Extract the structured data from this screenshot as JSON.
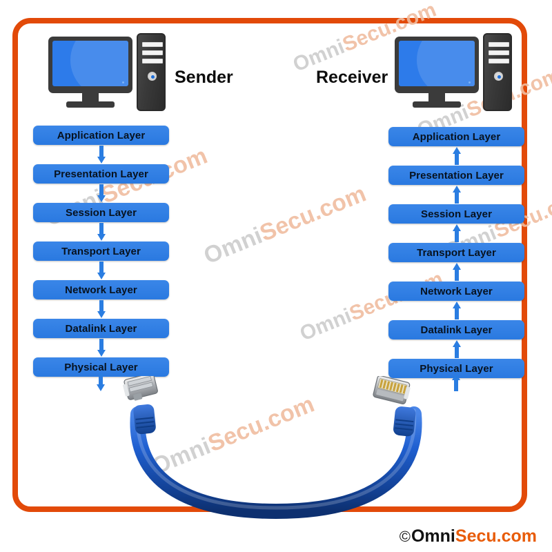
{
  "frame": {
    "border_color": "#E24A09"
  },
  "endpoints": {
    "sender": {
      "label": "Sender",
      "icon": "desktop-computer-icon"
    },
    "receiver": {
      "label": "Receiver",
      "icon": "desktop-computer-icon"
    }
  },
  "layers": {
    "names": [
      "Application Layer",
      "Presentation Layer",
      "Session Layer",
      "Transport Layer",
      "Network Layer",
      "Datalink Layer",
      "Physical Layer"
    ],
    "box_color": "#2a79e0",
    "text_color": "#07121f",
    "arrow_color": "#2a7de1",
    "sender_flow": "down",
    "receiver_flow": "up"
  },
  "cable": {
    "name": "ethernet-cable",
    "color": "#1f5fd0",
    "connector": "rj45-connector"
  },
  "watermarks": {
    "text_a": "Omni",
    "text_b": "Secu.com",
    "color_a": "#c9c9c9",
    "color_b": "#f0bda0"
  },
  "logo": {
    "copyright": "©",
    "part_a": "Omni",
    "part_b": "Secu.com",
    "color_a": "#121212",
    "color_b": "#E85C0A"
  }
}
